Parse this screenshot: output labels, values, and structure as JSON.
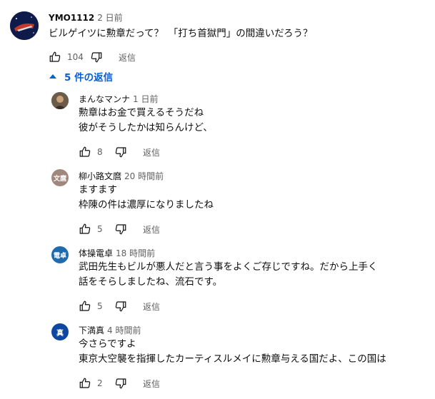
{
  "top_comment": {
    "author": "YMO1112",
    "time": "2 日前",
    "text": "ビルゲイツに勲章だって？　「打ち首獄門」の間違いだろう？",
    "likes": "104",
    "reply_label": "返信"
  },
  "replies_toggle": {
    "label": "5 件の返信"
  },
  "replies": [
    {
      "author": "まんなマンナ",
      "time": "1 日前",
      "lines": [
        "勲章はお金で買えるそうだね",
        "彼がそうしたかは知らんけど、"
      ],
      "likes": "8",
      "reply_label": "返信",
      "avatar_text": "",
      "avatar_color": "#7a6a5a"
    },
    {
      "author": "柳小路文麿",
      "time": "20 時間前",
      "lines": [
        "ますます",
        "枠陳の件は濃厚になりましたね"
      ],
      "likes": "5",
      "reply_label": "返信",
      "avatar_text": "文麿",
      "avatar_color": "#a1887f"
    },
    {
      "author": "体操電卓",
      "time": "18 時間前",
      "lines": [
        "武田先生もビルが悪人だと言う事をよくご存じですね。だから上手く",
        "話をそらしましたね、流石です。"
      ],
      "likes": "5",
      "reply_label": "返信",
      "avatar_text": "電卓",
      "avatar_color": "#1e6bb0"
    },
    {
      "author": "下満真",
      "time": "4 時間前",
      "lines": [
        "今さらですよ",
        "東京大空襲を指揮したカーティスルメイに勲章与える国だよ、この国は"
      ],
      "likes": "2",
      "reply_label": "返信",
      "avatar_text": "真",
      "avatar_color": "#0d47a1"
    }
  ]
}
